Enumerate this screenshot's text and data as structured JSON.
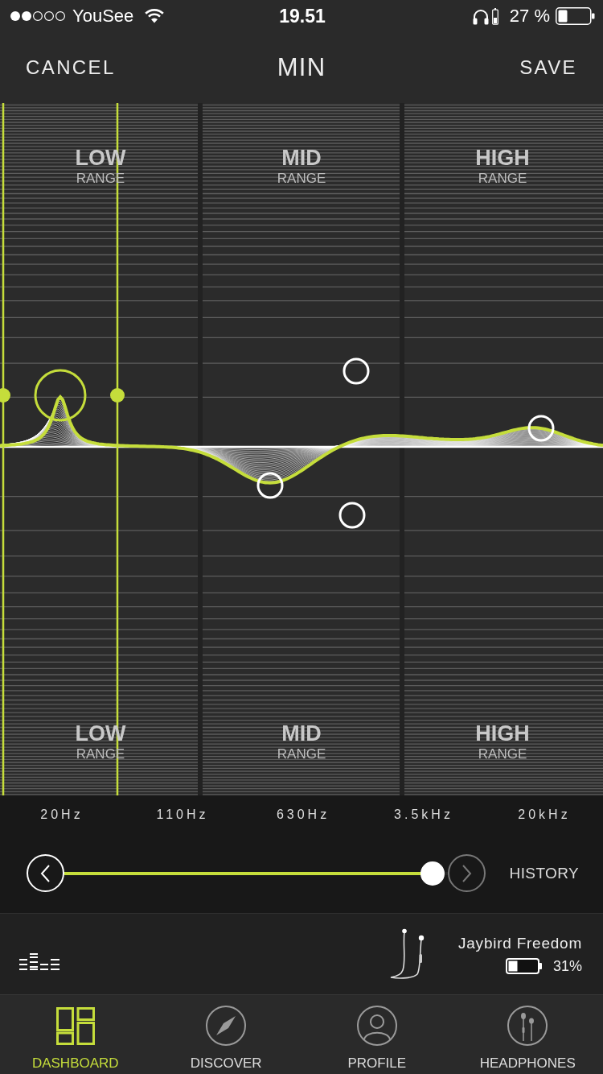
{
  "status_bar": {
    "carrier": "YouSee",
    "time": "19.51",
    "battery": "27 %"
  },
  "nav_bar": {
    "cancel": "CANCEL",
    "title": "MIN",
    "save": "SAVE"
  },
  "equalizer": {
    "top_labels": [
      {
        "title": "LOW",
        "subtitle": "RANGE"
      },
      {
        "title": "MID",
        "subtitle": "RANGE"
      },
      {
        "title": "HIGH",
        "subtitle": "RANGE"
      }
    ],
    "bottom_labels": [
      {
        "title": "LOW",
        "subtitle": "RANGE"
      },
      {
        "title": "MID",
        "subtitle": "RANGE"
      },
      {
        "title": "HIGH",
        "subtitle": "RANGE"
      }
    ],
    "handles": [
      {
        "selected": true
      },
      {
        "selected": false
      },
      {
        "selected": false
      },
      {
        "selected": false
      },
      {
        "selected": false
      }
    ]
  },
  "frequency_labels": [
    "20Hz",
    "110Hz",
    "630Hz",
    "3.5kHz",
    "20kHz"
  ],
  "history": {
    "label": "HISTORY",
    "level": 0.96,
    "back_button": {
      "disabled": false
    },
    "forward_button": {
      "disabled": true
    }
  },
  "device": {
    "name": "Jaybird Freedom",
    "battery": "31%"
  },
  "tabs": [
    {
      "label": "DASHBOARD",
      "selected": true
    },
    {
      "label": "DISCOVER",
      "selected": false
    },
    {
      "label": "PROFILE",
      "selected": false
    },
    {
      "label": "HEADPHONES",
      "selected": false
    }
  ]
}
